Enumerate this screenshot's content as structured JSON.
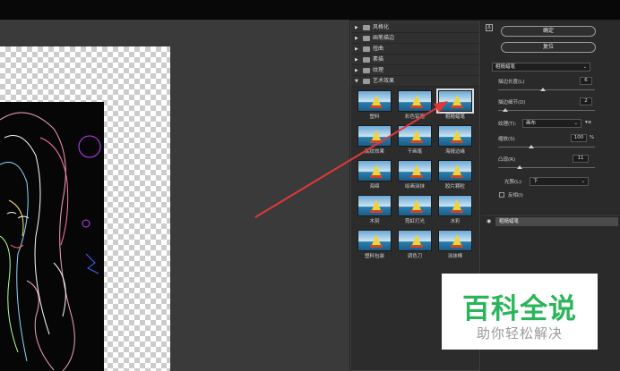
{
  "filter_gallery": {
    "categories": [
      {
        "label": "风格化",
        "expanded": false
      },
      {
        "label": "画笔描边",
        "expanded": false
      },
      {
        "label": "扭曲",
        "expanded": false
      },
      {
        "label": "素描",
        "expanded": false
      },
      {
        "label": "纹理",
        "expanded": false
      },
      {
        "label": "艺术效果",
        "expanded": true
      }
    ],
    "thumbnails": [
      {
        "label": "塑料",
        "selected": false
      },
      {
        "label": "彩色铅笔",
        "selected": false
      },
      {
        "label": "粗糙蜡笔",
        "selected": true
      },
      {
        "label": "底纹效果",
        "selected": false
      },
      {
        "label": "干画笔",
        "selected": false
      },
      {
        "label": "海报边缘",
        "selected": false
      },
      {
        "label": "海绵",
        "selected": false
      },
      {
        "label": "绘画涂抹",
        "selected": false
      },
      {
        "label": "胶片颗粒",
        "selected": false
      },
      {
        "label": "木刻",
        "selected": false
      },
      {
        "label": "霓虹灯光",
        "selected": false
      },
      {
        "label": "水彩",
        "selected": false
      },
      {
        "label": "塑料包装",
        "selected": false
      },
      {
        "label": "调色刀",
        "selected": false
      },
      {
        "label": "涂抹棒",
        "selected": false
      }
    ]
  },
  "settings": {
    "help_glyph": "Δ",
    "ok_label": "确定",
    "reset_label": "复位",
    "filter_select": "粗糙蜡笔",
    "stroke_length_label": "描边长度(L)",
    "stroke_length_value": "6",
    "stroke_detail_label": "描边细节(D)",
    "stroke_detail_value": "2",
    "texture_label": "纹理(T):",
    "texture_value": "画布",
    "scaling_label": "缩放(S)",
    "scaling_value": "100",
    "scaling_unit": "%",
    "relief_label": "凸现(R)",
    "relief_value": "11",
    "light_label": "光照(L):",
    "light_value": "下",
    "invert_label": "反相(I)"
  },
  "layers": {
    "active_filter": "粗糙蜡笔"
  },
  "watermark": {
    "title": "百科全说",
    "subtitle": "助你轻松解决"
  },
  "colors": {
    "arrow": "#e0383a",
    "watermark_green": "#2bb55a"
  }
}
